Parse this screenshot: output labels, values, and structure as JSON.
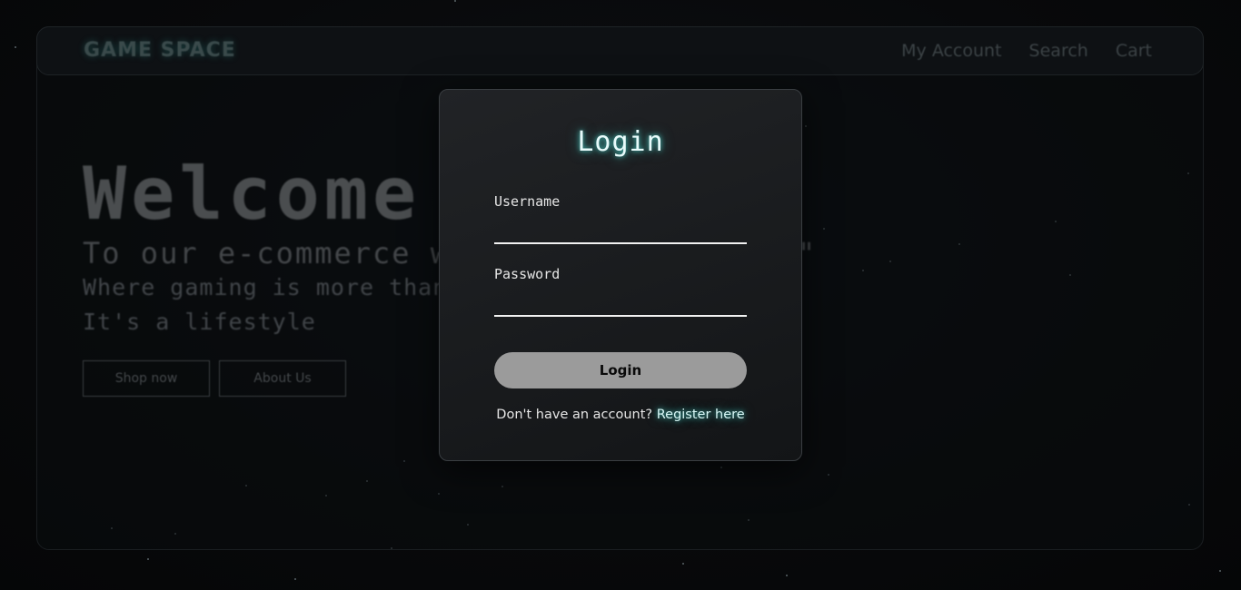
{
  "navbar": {
    "brand": "GAME SPACE",
    "links": [
      "My Account",
      "Search",
      "Cart"
    ]
  },
  "hero": {
    "title": "Welcome",
    "subtitle": "To our e-commerce website \"Game Space\"",
    "line1": "Where gaming is more than just a hobby",
    "line2": "It's a lifestyle",
    "buttons": [
      "Shop now",
      "About Us"
    ]
  },
  "login_modal": {
    "title": "Login",
    "username_label": "Username",
    "username_value": "",
    "password_label": "Password",
    "password_value": "",
    "submit_label": "Login",
    "register_prompt": "Don't have an account?",
    "register_link": "Register here"
  },
  "colors": {
    "accent_glow": "#4fe3d8",
    "background": "#060708",
    "button": "#9b9b9b"
  }
}
